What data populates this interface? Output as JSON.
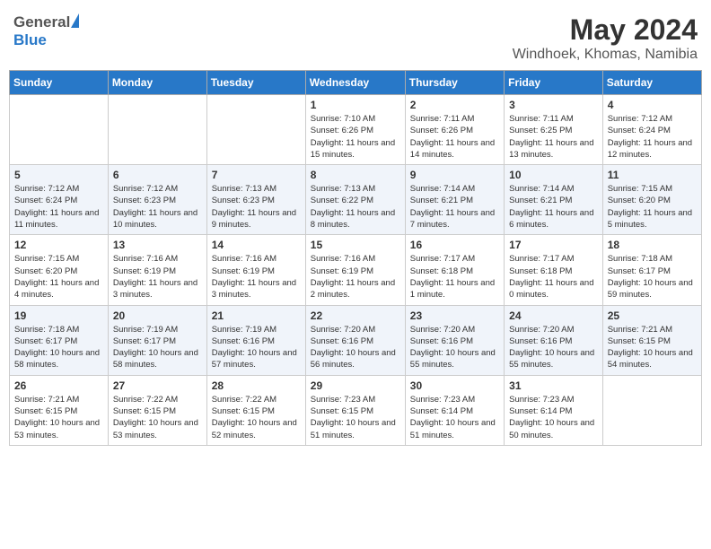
{
  "header": {
    "logo": {
      "general": "General",
      "blue": "Blue"
    },
    "title": "May 2024",
    "location": "Windhoek, Khomas, Namibia"
  },
  "columns": [
    "Sunday",
    "Monday",
    "Tuesday",
    "Wednesday",
    "Thursday",
    "Friday",
    "Saturday"
  ],
  "weeks": [
    [
      {
        "day": "",
        "info": ""
      },
      {
        "day": "",
        "info": ""
      },
      {
        "day": "",
        "info": ""
      },
      {
        "day": "1",
        "info": "Sunrise: 7:10 AM\nSunset: 6:26 PM\nDaylight: 11 hours and 15 minutes."
      },
      {
        "day": "2",
        "info": "Sunrise: 7:11 AM\nSunset: 6:26 PM\nDaylight: 11 hours and 14 minutes."
      },
      {
        "day": "3",
        "info": "Sunrise: 7:11 AM\nSunset: 6:25 PM\nDaylight: 11 hours and 13 minutes."
      },
      {
        "day": "4",
        "info": "Sunrise: 7:12 AM\nSunset: 6:24 PM\nDaylight: 11 hours and 12 minutes."
      }
    ],
    [
      {
        "day": "5",
        "info": "Sunrise: 7:12 AM\nSunset: 6:24 PM\nDaylight: 11 hours and 11 minutes."
      },
      {
        "day": "6",
        "info": "Sunrise: 7:12 AM\nSunset: 6:23 PM\nDaylight: 11 hours and 10 minutes."
      },
      {
        "day": "7",
        "info": "Sunrise: 7:13 AM\nSunset: 6:23 PM\nDaylight: 11 hours and 9 minutes."
      },
      {
        "day": "8",
        "info": "Sunrise: 7:13 AM\nSunset: 6:22 PM\nDaylight: 11 hours and 8 minutes."
      },
      {
        "day": "9",
        "info": "Sunrise: 7:14 AM\nSunset: 6:21 PM\nDaylight: 11 hours and 7 minutes."
      },
      {
        "day": "10",
        "info": "Sunrise: 7:14 AM\nSunset: 6:21 PM\nDaylight: 11 hours and 6 minutes."
      },
      {
        "day": "11",
        "info": "Sunrise: 7:15 AM\nSunset: 6:20 PM\nDaylight: 11 hours and 5 minutes."
      }
    ],
    [
      {
        "day": "12",
        "info": "Sunrise: 7:15 AM\nSunset: 6:20 PM\nDaylight: 11 hours and 4 minutes."
      },
      {
        "day": "13",
        "info": "Sunrise: 7:16 AM\nSunset: 6:19 PM\nDaylight: 11 hours and 3 minutes."
      },
      {
        "day": "14",
        "info": "Sunrise: 7:16 AM\nSunset: 6:19 PM\nDaylight: 11 hours and 3 minutes."
      },
      {
        "day": "15",
        "info": "Sunrise: 7:16 AM\nSunset: 6:19 PM\nDaylight: 11 hours and 2 minutes."
      },
      {
        "day": "16",
        "info": "Sunrise: 7:17 AM\nSunset: 6:18 PM\nDaylight: 11 hours and 1 minute."
      },
      {
        "day": "17",
        "info": "Sunrise: 7:17 AM\nSunset: 6:18 PM\nDaylight: 11 hours and 0 minutes."
      },
      {
        "day": "18",
        "info": "Sunrise: 7:18 AM\nSunset: 6:17 PM\nDaylight: 10 hours and 59 minutes."
      }
    ],
    [
      {
        "day": "19",
        "info": "Sunrise: 7:18 AM\nSunset: 6:17 PM\nDaylight: 10 hours and 58 minutes."
      },
      {
        "day": "20",
        "info": "Sunrise: 7:19 AM\nSunset: 6:17 PM\nDaylight: 10 hours and 58 minutes."
      },
      {
        "day": "21",
        "info": "Sunrise: 7:19 AM\nSunset: 6:16 PM\nDaylight: 10 hours and 57 minutes."
      },
      {
        "day": "22",
        "info": "Sunrise: 7:20 AM\nSunset: 6:16 PM\nDaylight: 10 hours and 56 minutes."
      },
      {
        "day": "23",
        "info": "Sunrise: 7:20 AM\nSunset: 6:16 PM\nDaylight: 10 hours and 55 minutes."
      },
      {
        "day": "24",
        "info": "Sunrise: 7:20 AM\nSunset: 6:16 PM\nDaylight: 10 hours and 55 minutes."
      },
      {
        "day": "25",
        "info": "Sunrise: 7:21 AM\nSunset: 6:15 PM\nDaylight: 10 hours and 54 minutes."
      }
    ],
    [
      {
        "day": "26",
        "info": "Sunrise: 7:21 AM\nSunset: 6:15 PM\nDaylight: 10 hours and 53 minutes."
      },
      {
        "day": "27",
        "info": "Sunrise: 7:22 AM\nSunset: 6:15 PM\nDaylight: 10 hours and 53 minutes."
      },
      {
        "day": "28",
        "info": "Sunrise: 7:22 AM\nSunset: 6:15 PM\nDaylight: 10 hours and 52 minutes."
      },
      {
        "day": "29",
        "info": "Sunrise: 7:23 AM\nSunset: 6:15 PM\nDaylight: 10 hours and 51 minutes."
      },
      {
        "day": "30",
        "info": "Sunrise: 7:23 AM\nSunset: 6:14 PM\nDaylight: 10 hours and 51 minutes."
      },
      {
        "day": "31",
        "info": "Sunrise: 7:23 AM\nSunset: 6:14 PM\nDaylight: 10 hours and 50 minutes."
      },
      {
        "day": "",
        "info": ""
      }
    ]
  ]
}
